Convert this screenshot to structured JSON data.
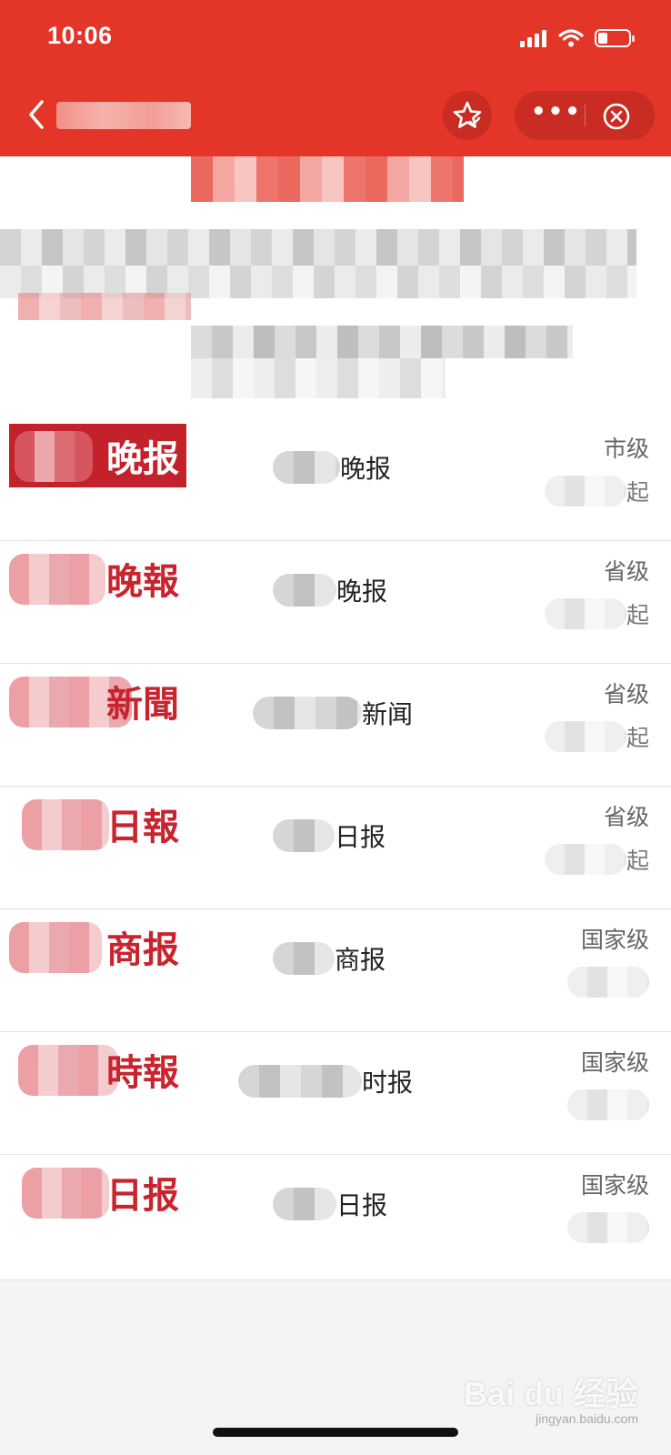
{
  "status_bar": {
    "time": "10:06",
    "battery_level": 0.3
  },
  "nav": {
    "back_icon": "chevron-left-icon",
    "favorite_icon": "star-check-icon",
    "more_icon": "more-dots-icon",
    "more_label": "•••",
    "close_icon": "close-circle-icon"
  },
  "colors": {
    "brand_red": "#e33528",
    "capsule_red": "#c92c22",
    "logo_red": "#c9242e"
  },
  "list": {
    "rows": [
      {
        "logo": "晚报",
        "logo_style": "boxed",
        "name_suffix": "晚报",
        "level": "市级",
        "price_suffix": "起"
      },
      {
        "logo": "晚報",
        "logo_style": "plain",
        "name_suffix": "晚报",
        "level": "省级",
        "price_suffix": "起"
      },
      {
        "logo": "新聞",
        "logo_style": "plain",
        "name_suffix": "新闻",
        "level": "省级",
        "price_suffix": "起"
      },
      {
        "logo": "日報",
        "logo_style": "plain",
        "name_suffix": "日报",
        "level": "省级",
        "price_suffix": "起"
      },
      {
        "logo": "商报",
        "logo_style": "plain",
        "name_suffix": "商报",
        "level": "国家级",
        "price_suffix": ""
      },
      {
        "logo": "時報",
        "logo_style": "plain",
        "name_suffix": "时报",
        "level": "国家级",
        "price_suffix": ""
      },
      {
        "logo": "日报",
        "logo_style": "plain",
        "name_suffix": "日报",
        "level": "国家级",
        "price_suffix": ""
      }
    ]
  },
  "watermark": {
    "brand": "Bai du 经验",
    "url": "jingyan.baidu.com"
  }
}
